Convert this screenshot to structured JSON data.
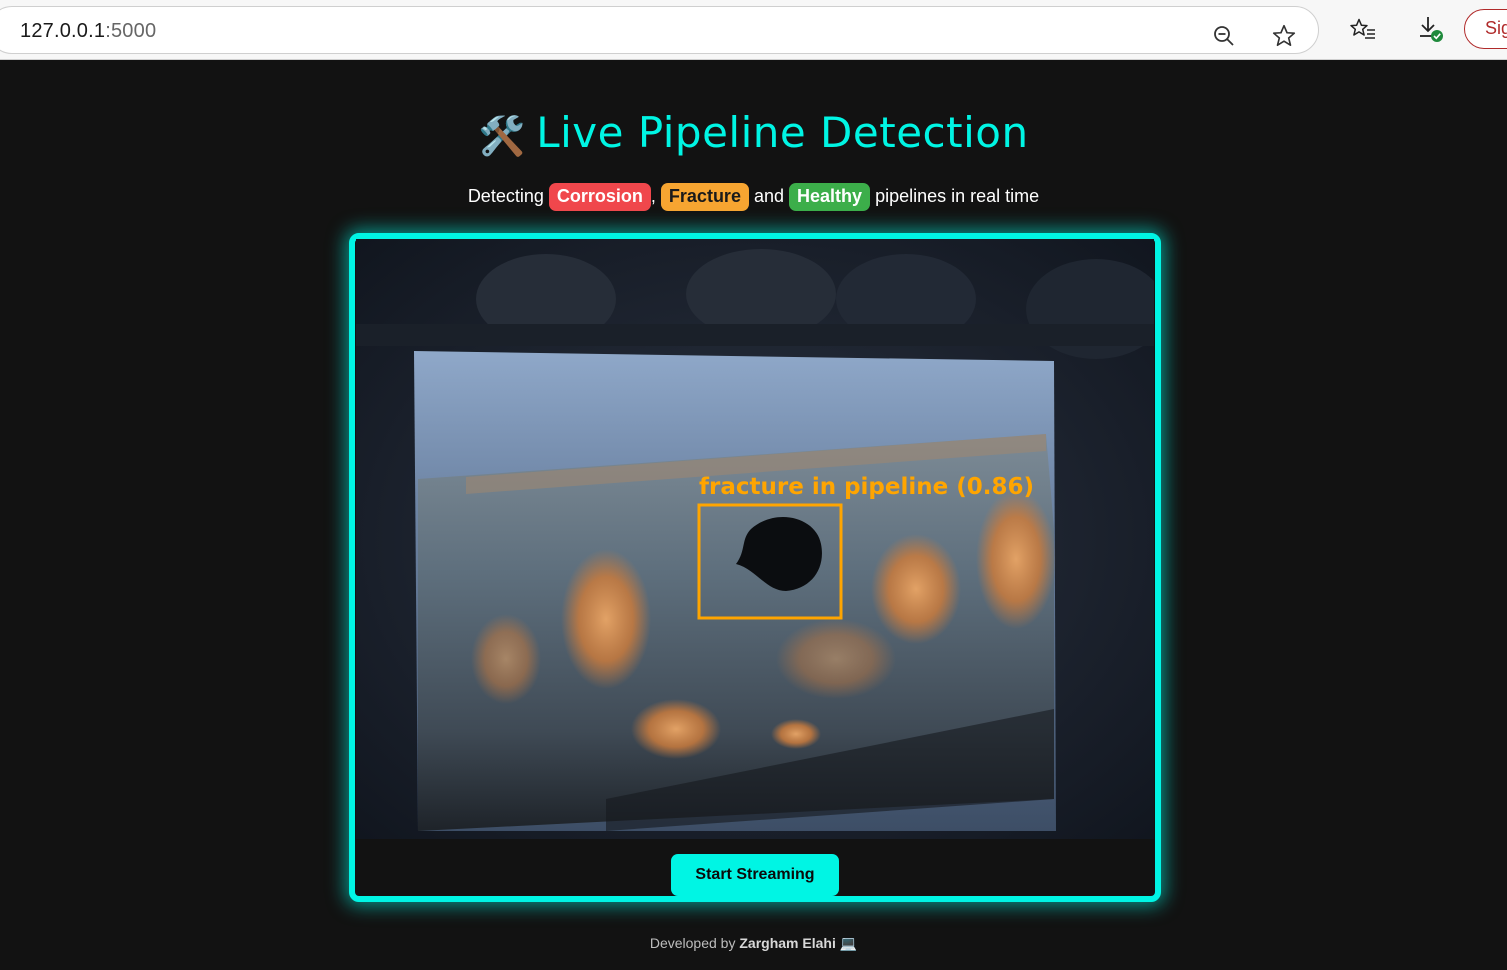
{
  "browser": {
    "url_host": "127.0.0.1",
    "url_port": ":5000",
    "sign_in_label": "Sign in",
    "icons": [
      "zoom-out-icon",
      "star-icon",
      "favorites-icon",
      "download-icon"
    ]
  },
  "page": {
    "title_icon": "🛠️",
    "title": "Live Pipeline Detection",
    "subtitle_prefix": "Detecting",
    "badge_corrosion": "Corrosion",
    "comma": ",",
    "badge_fracture": "Fracture",
    "and_text": "and",
    "badge_healthy": "Healthy",
    "subtitle_suffix": "pipelines in real time",
    "detection_label": "fracture in pipeline (0.86)",
    "start_button": "Start Streaming",
    "footer_prefix": "Developed by",
    "footer_author": "Zargham Elahi",
    "footer_icon": "💻",
    "colors": {
      "accent": "#00f5e4",
      "corrosion": "#f0474c",
      "fracture": "#f7a531",
      "healthy": "#3cae4a",
      "background": "#121212",
      "detection_box": "#ffa500"
    }
  }
}
